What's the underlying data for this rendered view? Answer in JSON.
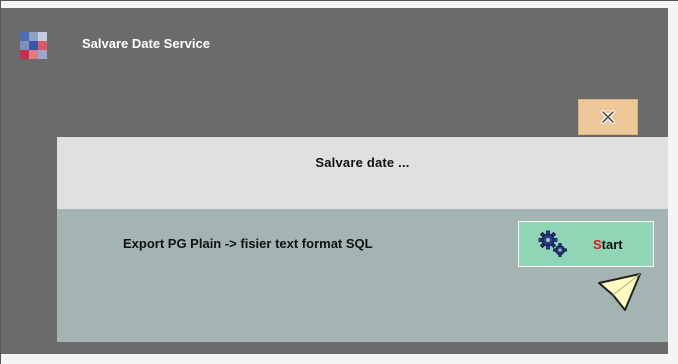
{
  "window": {
    "title": "Salvare Date Service",
    "logo_icon": "app-logo-icon"
  },
  "close_button": {
    "icon": "close-icon",
    "color": "#efc89a"
  },
  "header": {
    "title": "Salvare date ..."
  },
  "task": {
    "label": "Export PG Plain -> fisier text format SQL",
    "start_button": {
      "first_letter": "S",
      "rest": "tart",
      "icon": "gears-icon",
      "color": "#8fd6b6"
    }
  },
  "colors": {
    "window_bg": "#6b6b6b",
    "header_bg": "#e0e0e0",
    "panel_bg": "#a3b4b2",
    "accent_red": "#d21d1d"
  }
}
